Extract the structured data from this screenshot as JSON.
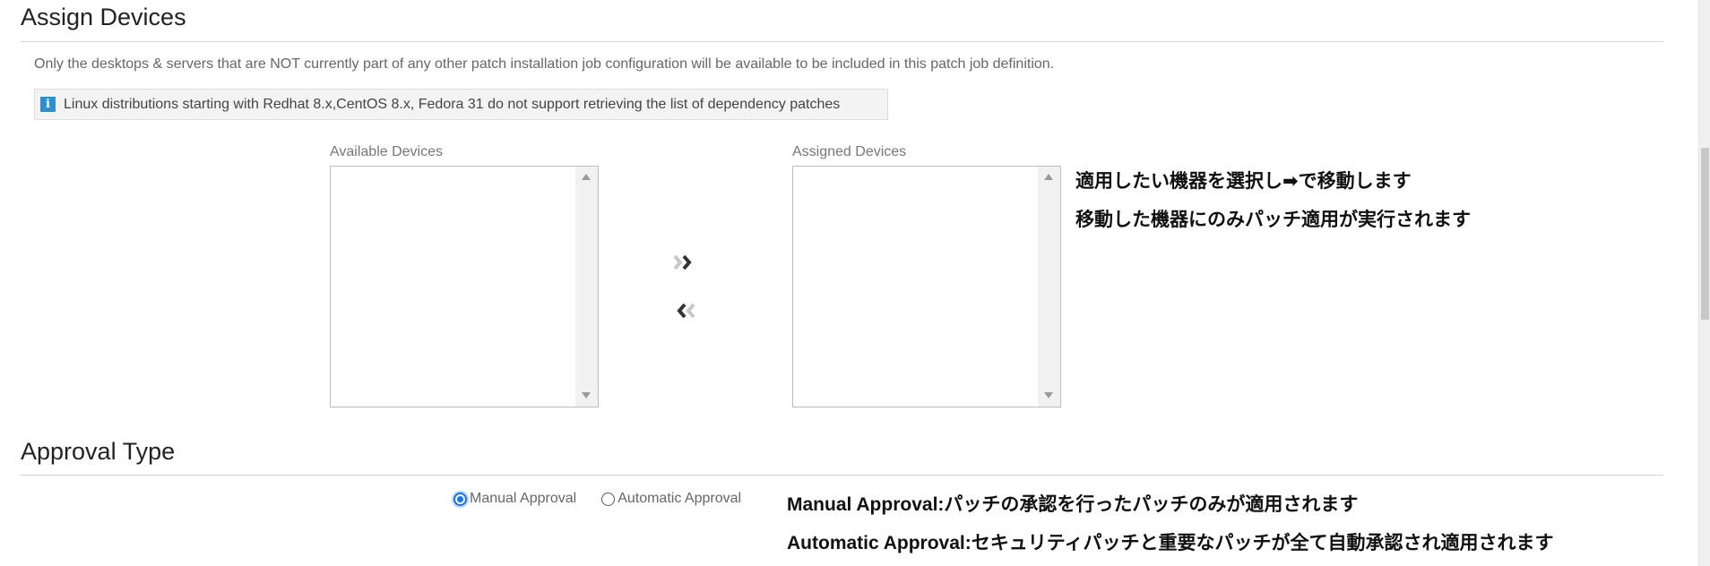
{
  "assign_devices": {
    "title": "Assign Devices",
    "note": "Only the desktops & servers that are NOT currently part of any other patch installation job configuration will be available to be included in this patch job definition.",
    "info": "Linux distributions starting with Redhat 8.x,CentOS 8.x, Fedora 31 do not support retrieving the list of dependency patches",
    "info_icon": "info-icon",
    "available_label": "Available Devices",
    "assigned_label": "Assigned Devices",
    "available_items": [],
    "assigned_items": [],
    "move_right_icon": "double-chevron-right-icon",
    "move_left_icon": "double-chevron-left-icon",
    "annotation_line1": "適用したい機器を選択し➡で移動します",
    "annotation_line2": "移動した機器にのみパッチ適用が実行されます"
  },
  "approval_type": {
    "title": "Approval Type",
    "options": [
      {
        "label": "Manual Approval",
        "selected": true
      },
      {
        "label": "Automatic Approval",
        "selected": false
      }
    ],
    "annotation_line1": "Manual Approval:パッチの承認を行ったパッチのみが適用されます",
    "annotation_line2": "Automatic Approval:セキュリティパッチと重要なパッチが全て自動承認され適用されます"
  },
  "colors": {
    "accent": "#1a73e8",
    "info_icon": "#2d8fcf"
  }
}
